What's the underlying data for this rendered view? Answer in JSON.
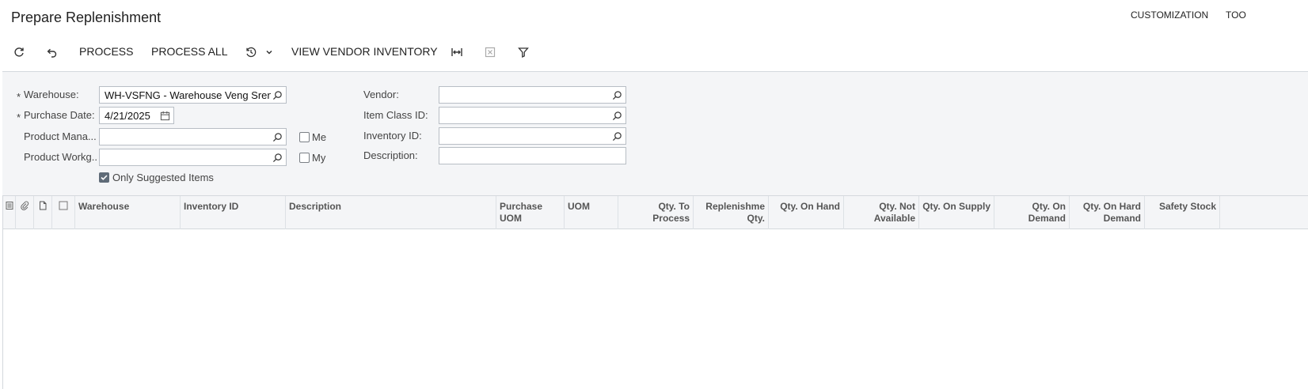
{
  "header": {
    "title": "Prepare Replenishment",
    "links": [
      "CUSTOMIZATION",
      "TOO"
    ]
  },
  "toolbar": {
    "refresh_icon": "refresh-icon",
    "undo_icon": "undo-icon",
    "process": "PROCESS",
    "process_all": "PROCESS ALL",
    "schedule_icon": "schedule-clock-icon",
    "view_vendor_inventory": "VIEW VENDOR INVENTORY",
    "fit_width_icon": "fit-width-icon",
    "export_excel_icon": "excel-export-icon",
    "filter_icon": "filter-icon"
  },
  "filters": {
    "warehouse": {
      "label": "Warehouse:",
      "value": "WH-VSFNG - Warehouse Veng Sreng",
      "required": "*"
    },
    "purchase_date": {
      "label": "Purchase Date:",
      "value": "4/21/2025",
      "required": "*"
    },
    "product_manager": {
      "label": "Product Mana...",
      "value": "",
      "me_label": "Me"
    },
    "product_workgroup": {
      "label": "Product Workg...",
      "value": "",
      "my_label": "My"
    },
    "only_suggested": {
      "label": "Only Suggested Items",
      "checked": true
    },
    "vendor": {
      "label": "Vendor:",
      "value": ""
    },
    "item_class": {
      "label": "Item Class ID:",
      "value": ""
    },
    "inventory_id": {
      "label": "Inventory ID:",
      "value": ""
    },
    "description": {
      "label": "Description:",
      "value": ""
    }
  },
  "grid": {
    "columns": [
      "Warehouse",
      "Inventory ID",
      "Description",
      "Purchase UOM",
      "UOM",
      "Qty. To Process",
      "Replenishme Qty.",
      "Qty. On Hand",
      "Qty. Not Available",
      "Qty. On Supply",
      "Qty. On Demand",
      "Qty. On Hard Demand",
      "Safety Stock"
    ],
    "rows": []
  }
}
